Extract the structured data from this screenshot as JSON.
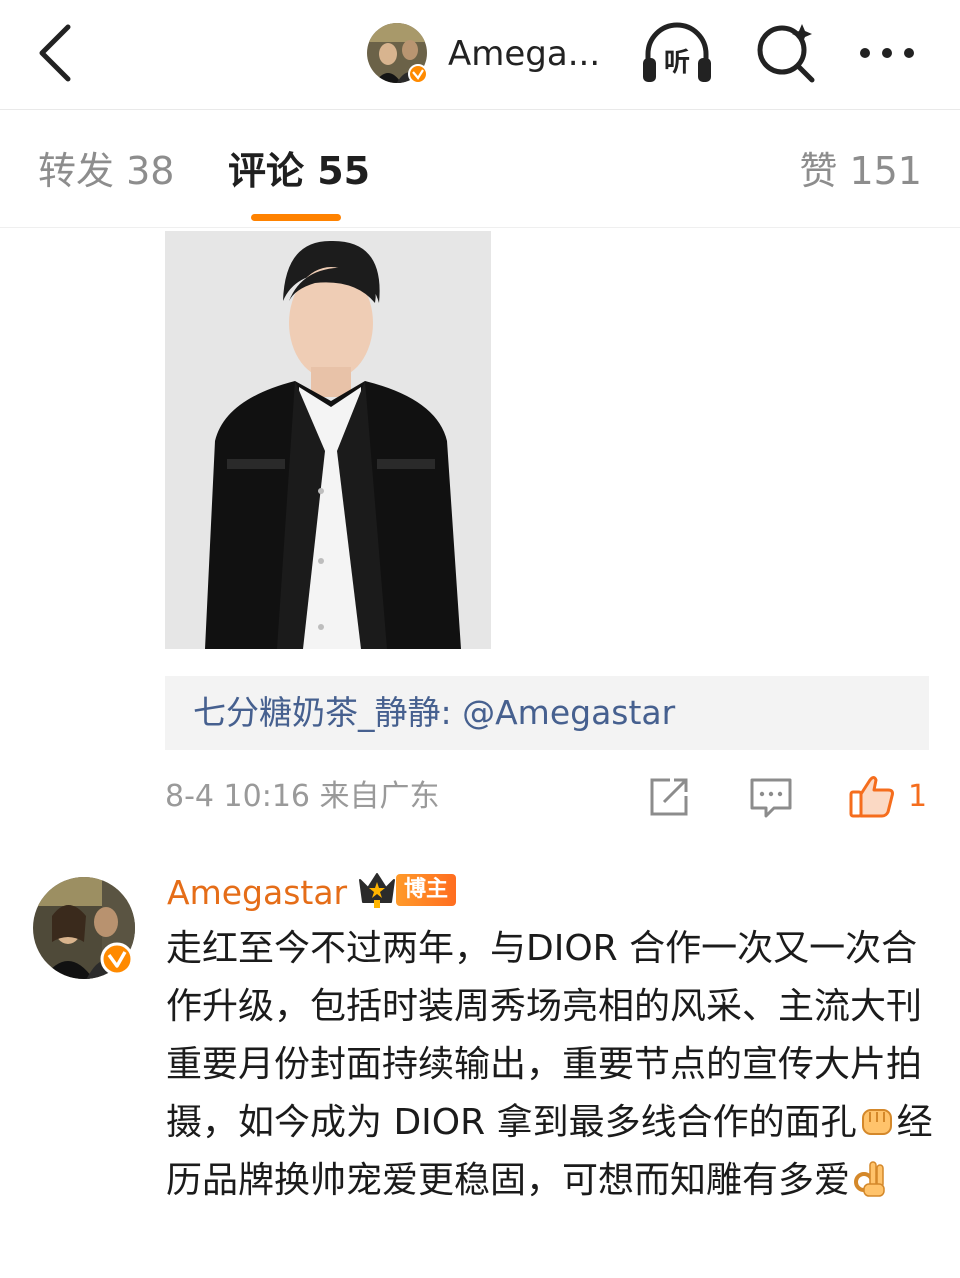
{
  "nav": {
    "title": "Amega...",
    "listen_label": "听",
    "icons": [
      "back-arrow-icon",
      "headphones-icon",
      "search-icon",
      "more-icon"
    ]
  },
  "tabs": {
    "repost": "转发 38",
    "comment": "评论 55",
    "like": "赞 151",
    "active": "comment",
    "accent_color": "#ff8200"
  },
  "comment1": {
    "reply_user": "七分糖奶茶_静静",
    "reply_sep": ": ",
    "reply_mention": "@Amegastar",
    "meta": "8-4 10:16 来自广东",
    "like_count": "1"
  },
  "comment2": {
    "user": "Amegastar",
    "badge": "博主",
    "text_part1": "走红至今不过两年，与DIOR 合作一次又一次合作升级，包括时装周秀场亮相的风采、主流大刊重要月份封面持续输出，重要节点的宣传大片拍摄，如今成为 DIOR 拿到最多线合作的面孔",
    "text_part2": "经历品牌换帅宠爱更稳固，可想而知雕有多爱",
    "emoji1": "fist-emoji",
    "emoji2": "ok-hand-emoji",
    "name_color": "#e56d18"
  }
}
